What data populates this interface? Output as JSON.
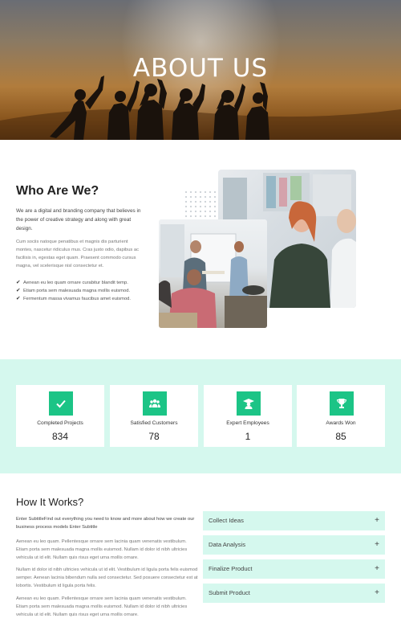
{
  "hero": {
    "title": "ABOUT US"
  },
  "about": {
    "title": "Who Are We?",
    "lead": "We are a digital and branding company that believes in the power of creative strategy and along with great design.",
    "body": "Cum sociis natoque penatibus et magnis dis parturient montes, nascetur ridiculus mus. Cras justo odio, dapibus ac facilisis in, egestas eget quam. Praesent commodo cursus magna, vel scelerisque nisl consectetur et.",
    "features": [
      "Aenean eu leo quam ornare curabitur blandit temp.",
      "Etiam porta sem malesuada magna mollis euismod.",
      "Fermentum massa vivamus faucibus amet euismod."
    ]
  },
  "stats": [
    {
      "label": "Completed Projects",
      "value": "834",
      "icon": "check-icon"
    },
    {
      "label": "Satisfied Customers",
      "value": "78",
      "icon": "users-icon"
    },
    {
      "label": "Expert Employees",
      "value": "1",
      "icon": "graduate-icon"
    },
    {
      "label": "Awards Won",
      "value": "85",
      "icon": "trophy-icon"
    }
  ],
  "how": {
    "title": "How It Works?",
    "subtitle": "Enter SubtitleFind out everything you need to know and more about how we create our business process models Enter Subtitle",
    "paragraphs": [
      "Aenean eu leo quam. Pellentesque ornare sem lacinia quam venenatis vestibulum. Etiam porta sem malesuada magna mollis euismod. Nullam id dolor id nibh ultricies vehicula ut id elit. Nullam quis risus eget urna mollis ornare.",
      "Nullam id dolor id nibh ultricies vehicula ut id elit. Vestibulum id ligula porta felis euismod semper. Aenean lacinia bibendum nulla sed consectetur. Sed posuere consectetur est at lobortis. Vestibulum id ligula porta felis.",
      "Aenean eu leo quam. Pellentesque ornare sem lacinia quam venenatis vestibulum. Etiam porta sem malesuada magna mollis euismod. Nullam id dolor id nibh ultricies vehicula ut id elit. Nullam quis risus eget urna mollis ornare."
    ],
    "accordion": [
      "Collect Ideas",
      "Data Analysis",
      "Finalize Product",
      "Submit Product"
    ],
    "expand_symbol": "+"
  },
  "colors": {
    "accent": "#1cc486",
    "mint": "#d5f8ee"
  }
}
